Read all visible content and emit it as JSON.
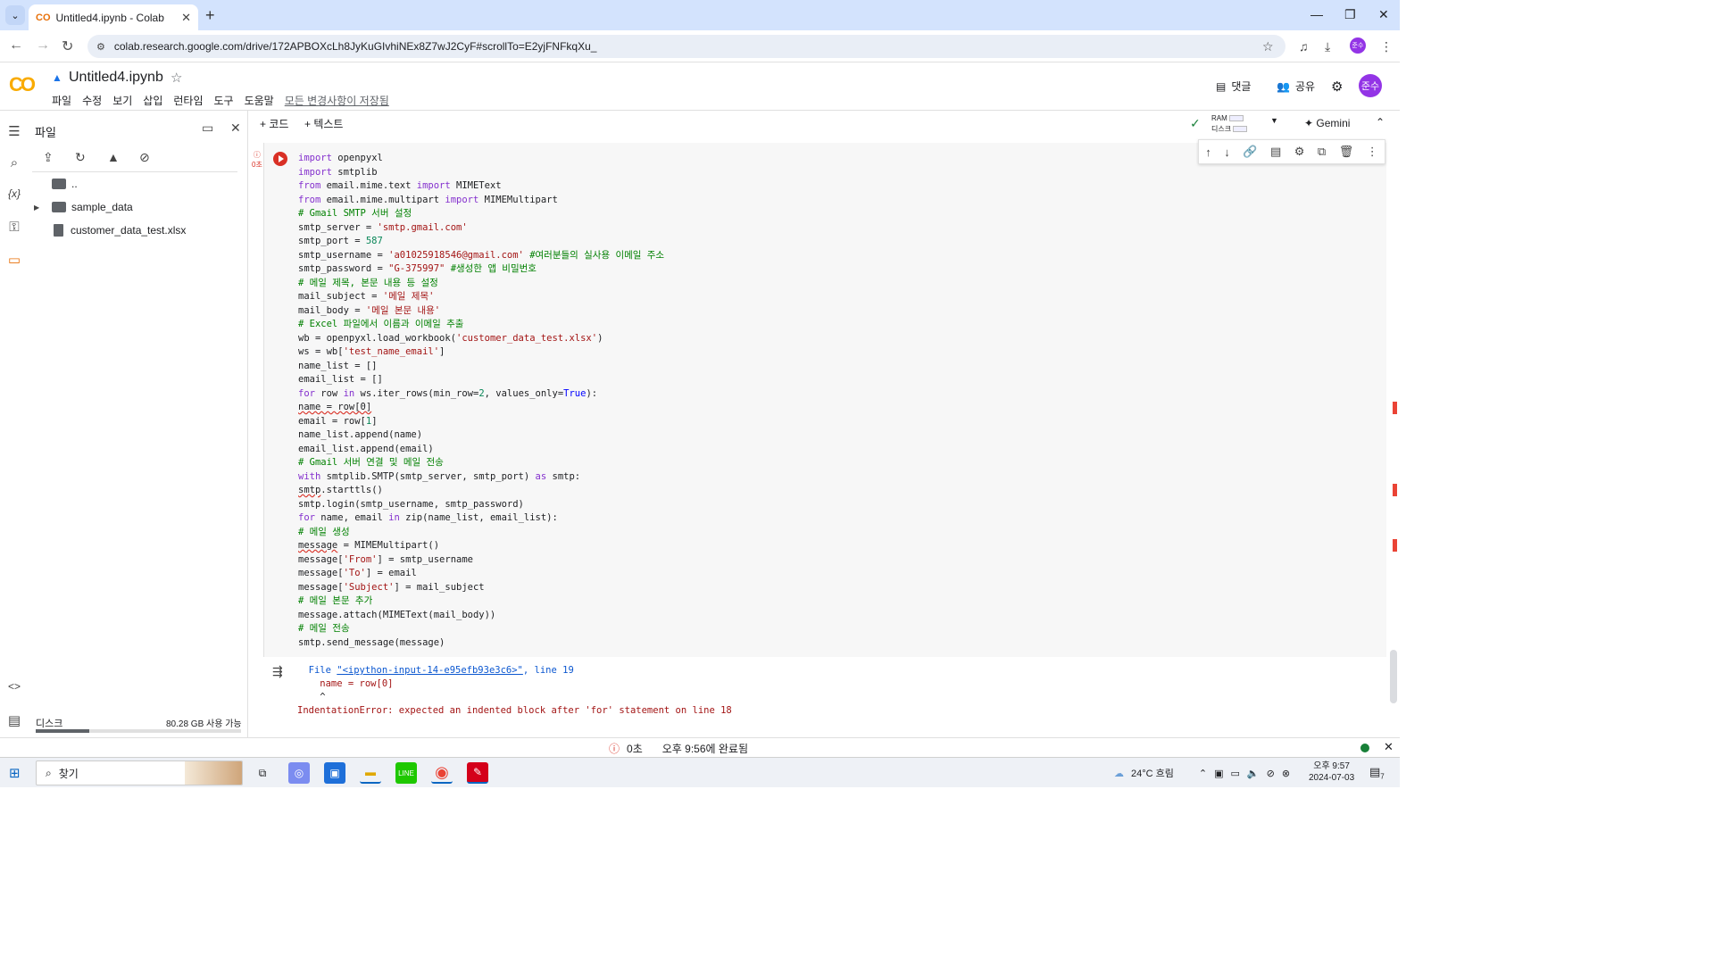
{
  "browser": {
    "tab_title": "Untitled4.ipynb - Colab",
    "url": "colab.research.google.com/drive/172APBOXcLh8JyKuGIvhiNEx8Z7wJ2CyF#scrollTo=E2yjFNFkqXu_",
    "profile_initials": "준수"
  },
  "colab": {
    "logo": "CO",
    "notebook_title": "Untitled4.ipynb",
    "menu": [
      "파일",
      "수정",
      "보기",
      "삽입",
      "런타임",
      "도구",
      "도움말"
    ],
    "saved_status": "모든 변경사항이 저장됨",
    "comment_label": "댓글",
    "share_label": "공유",
    "avatar_initials": "준수"
  },
  "file_panel": {
    "title": "파일",
    "items": [
      {
        "name": "..",
        "type": "folder-up"
      },
      {
        "name": "sample_data",
        "type": "folder"
      },
      {
        "name": "customer_data_test.xlsx",
        "type": "file"
      }
    ],
    "disk_label": "디스크",
    "disk_available": "80.28 GB 사용 가능",
    "disk_used_fraction": 0.26
  },
  "toolbar": {
    "add_code": "+ 코드",
    "add_text": "+ 텍스트",
    "ram_label": "RAM",
    "disk_label": "디스크",
    "gemini_label": "Gemini"
  },
  "cell": {
    "exec_time": "0초"
  },
  "output": {
    "file_prefix": "File ",
    "file_link": "\"<ipython-input-14-e95efb93e3c6>\"",
    "file_suffix": ", line 19",
    "code_line": "    name = row[0]",
    "caret": "    ^",
    "error": "IndentationError: expected an indented block after 'for' statement on line 18"
  },
  "statusbar": {
    "time_spent": "0초",
    "completed": "오후 9:56에 완료됨"
  },
  "taskbar": {
    "search_placeholder": "찾기",
    "weather": "24°C 흐림",
    "time": "오후 9:57",
    "date": "2024-07-03",
    "notif_count": "7"
  },
  "colors": {
    "tabstrip": "#d3e3fd",
    "keyword": "#8430ce",
    "string": "#a31515",
    "comment": "#008000",
    "error": "#d93025"
  }
}
